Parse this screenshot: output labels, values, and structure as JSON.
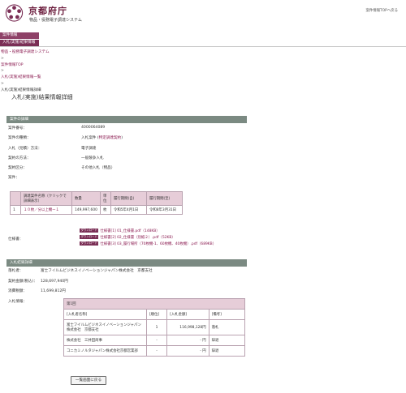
{
  "header": {
    "site_title": "京都府庁",
    "site_subtitle": "物品・役務電子調達システム",
    "top_link": "案件情報TOPへ戻る"
  },
  "nav": {
    "tab1": "案件情報",
    "tab2": "入札(実施)結果情報"
  },
  "breadcrumb": {
    "items": [
      "物品・役務電子調達システム",
      ">",
      "案件情報TOP",
      ">",
      "入札(実施)結果情報一覧",
      ">",
      "入札(実施)結果情報詳細"
    ]
  },
  "page_title": "入札(実施)結果情報詳細",
  "details": {
    "section_title": "案件の詳細",
    "rows": [
      {
        "label": "案件番号：",
        "value": "4000064089"
      },
      {
        "label": "案件の種類：",
        "value": "入札案件 (",
        "link": "特定調達契約",
        "value_end": ")"
      },
      {
        "label": "入札（見積）方法：",
        "value": "電子調達"
      },
      {
        "label": "契約の方法：",
        "value": "一般競争入札"
      },
      {
        "label": "契約区分：",
        "value": "その他入札（物品）"
      },
      {
        "label": "案件：",
        "value": ""
      }
    ]
  },
  "procurement_table": {
    "headers": [
      "",
      "調達案件名称（クリックで詳細表示）",
      "数量",
      "単位",
      "履行期間(自)",
      "履行期間(至)"
    ],
    "rows": [
      {
        "no": "1",
        "name": "１０枚／分以上機ー１",
        "qty": "149,997,600",
        "unit": "枚",
        "from": "令和5年4月1日",
        "to": "令和8年3月31日"
      }
    ]
  },
  "spec": {
    "label": "仕様書：",
    "badge": "ダウンロード",
    "files": [
      "仕様書[1] 01_仕様書.pdf（148KB）",
      "仕様書[2] 02_仕様書（別紙２）.pdf（52KB）",
      "仕様書[3] 03_履行場所（70枚機-1、60枚機、40枚機）.pdf（689KB）"
    ]
  },
  "results": {
    "section_title": "入札結果詳細",
    "rows": [
      {
        "label": "落札者：",
        "value": "富士フイルムビジネスイノベーションジャパン株式会社　京都支社"
      },
      {
        "label": "契約金額(税込)：",
        "value": "128,697,940円"
      },
      {
        "label": "消費税額：",
        "value": "11,699,812円"
      },
      {
        "label": "入札情報：",
        "value": ""
      }
    ],
    "bid_round": "第1回",
    "bid_headers": [
      "[入札者名称]",
      "[順位]",
      "[入札金額]",
      "[備考]"
    ],
    "bids": [
      {
        "name": "富士フイルムビジネスイノベーションジャパン株式会社　京都支社",
        "rank": "1",
        "amount": "116,998,128円",
        "note": "落札"
      },
      {
        "name": "株式会社　三井田商事",
        "rank": "-",
        "amount": "- 円",
        "note": "辞退"
      },
      {
        "name": "コニカミノルタジャパン株式会社京都営業部",
        "rank": "-",
        "amount": "- 円",
        "note": "辞退"
      }
    ]
  },
  "back_button": "一覧画面に戻る"
}
